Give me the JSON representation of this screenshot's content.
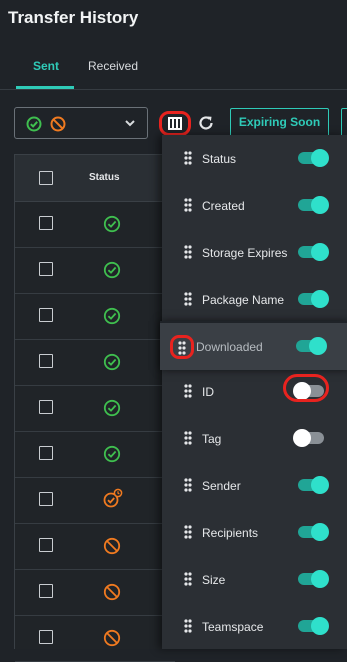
{
  "page": {
    "title": "Transfer History"
  },
  "tabs": [
    {
      "label": "Sent"
    },
    {
      "label": "Received"
    }
  ],
  "toolbar": {
    "status_filter": {
      "selected": [
        "completed",
        "cancelled"
      ]
    },
    "expiring_label": "Expiring Soon"
  },
  "table": {
    "header": {
      "status": "Status"
    },
    "rows": [
      {
        "status": "completed"
      },
      {
        "status": "completed"
      },
      {
        "status": "completed"
      },
      {
        "status": "completed"
      },
      {
        "status": "completed"
      },
      {
        "status": "completed"
      },
      {
        "status": "expiring"
      },
      {
        "status": "cancelled"
      },
      {
        "status": "cancelled"
      },
      {
        "status": "cancelled"
      }
    ]
  },
  "column_menu": {
    "items": [
      {
        "label": "Status",
        "enabled": true
      },
      {
        "label": "Created",
        "enabled": true
      },
      {
        "label": "Storage Expires",
        "enabled": true
      },
      {
        "label": "Package Name",
        "enabled": true
      },
      {
        "label": "Downloaded",
        "enabled": true
      },
      {
        "label": "ID",
        "enabled": false
      },
      {
        "label": "Tag",
        "enabled": false
      },
      {
        "label": "Sender",
        "enabled": true
      },
      {
        "label": "Recipients",
        "enabled": true
      },
      {
        "label": "Size",
        "enabled": true
      },
      {
        "label": "Teamspace",
        "enabled": true
      }
    ]
  },
  "colors": {
    "accent": "#2fcbb8",
    "success": "#3fbf4f",
    "warning": "#f07a20",
    "highlight": "#e8231f"
  }
}
